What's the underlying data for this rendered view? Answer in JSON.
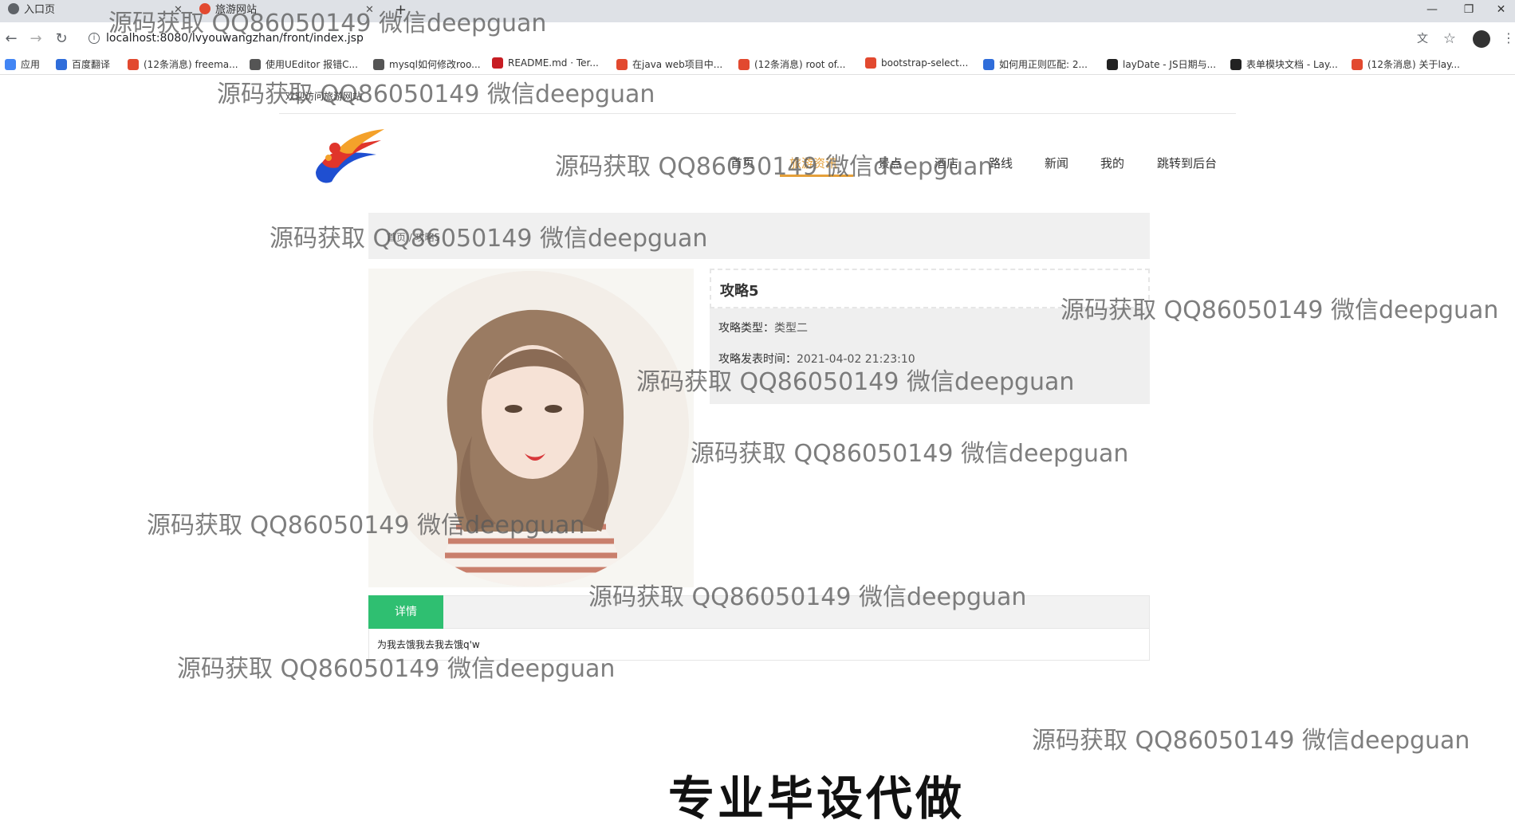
{
  "browser": {
    "tabs": [
      {
        "title": "入口页"
      },
      {
        "title": "旅游网站"
      }
    ],
    "new_tab_glyph": "+",
    "window_controls": [
      "—",
      "❐",
      "✕"
    ],
    "url": "localhost:8080/lvyouwangzhan/front/index.jsp",
    "bookmarks": [
      {
        "label": "应用",
        "color": "#4285f4"
      },
      {
        "label": "百度翻译",
        "color": "#2f6dda"
      },
      {
        "label": "(12条消息) freema...",
        "color": "#e2492f"
      },
      {
        "label": "使用UEditor 报错C...",
        "color": "#555555"
      },
      {
        "label": "mysql如何修改roo...",
        "color": "#555555"
      },
      {
        "label": "README.md · Ter...",
        "color": "#c71d23"
      },
      {
        "label": "在java web项目中...",
        "color": "#e2492f"
      },
      {
        "label": "(12条消息) root of...",
        "color": "#e2492f"
      },
      {
        "label": "bootstrap-select...",
        "color": "#e2492f"
      },
      {
        "label": "如何用正则匹配: 2...",
        "color": "#2f6dda"
      },
      {
        "label": "layDate - JS日期与...",
        "color": "#222222"
      },
      {
        "label": "表单模块文档 - Lay...",
        "color": "#222222"
      },
      {
        "label": "(12条消息) 关于lay...",
        "color": "#e2492f"
      }
    ]
  },
  "site": {
    "welcome": "欢迎访问旅游网站",
    "nav": [
      "首页",
      "旅游资讯",
      "景点",
      "酒店",
      "路线",
      "新闻",
      "我的",
      "跳转到后台"
    ],
    "active_nav_index": 1,
    "accent": "#e5a03a",
    "breadcrumb": "首页 / 攻略5"
  },
  "article": {
    "title": "攻略5",
    "type_label": "攻略类型：",
    "type_value": "类型二",
    "time_label": "攻略发表时间：",
    "time_value": "2021-04-02 21:23:10",
    "detail_tab": "详情",
    "detail_tab_color": "#2fbf71",
    "content": "为我去饿我去我去饿q'w"
  },
  "promo": "专业毕设代做",
  "watermark": "源码获取 QQ86050149 微信deepguan"
}
